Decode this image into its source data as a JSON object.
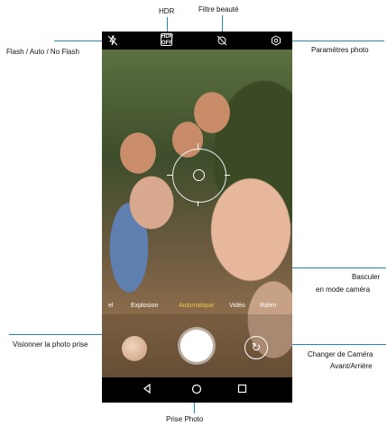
{
  "top_labels": {
    "hdr": "HDR",
    "beauty": "Filtre beauté"
  },
  "callouts": {
    "flash": "Flash / Auto / No Flash",
    "settings": "Paramètres photo",
    "switch_mode_line1": "Basculer",
    "switch_mode_line2": "en mode caméra",
    "view_photo": "Visionner la photo prise",
    "change_camera_line1": "Changer de Caméra",
    "change_camera_line2": "Avant/Arrière",
    "shutter": "Prise Photo"
  },
  "camera": {
    "hdr_badge_line1": "HDR",
    "hdr_badge_line2": "OFF",
    "modes": [
      "el",
      "Explosion",
      "Automatique",
      "Vidéo",
      "Ralen"
    ],
    "active_mode": "Automatique"
  },
  "icons": {
    "flash": "flash-off-icon",
    "beauty": "beauty-filter-icon",
    "settings": "settings-gear-icon",
    "switch_camera": "switch-camera-icon",
    "back": "nav-back-icon",
    "home": "nav-home-icon",
    "recents": "nav-recents-icon"
  },
  "colors": {
    "callout_line": "#1f8ac6",
    "active_mode": "#f2c744"
  }
}
